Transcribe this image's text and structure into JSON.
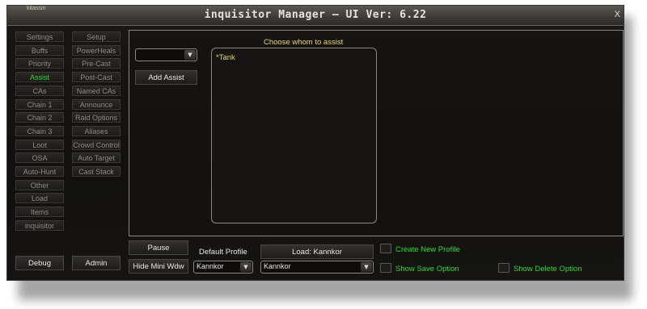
{
  "window": {
    "title": "inquisitor Manager  — UI Ver: 6.22",
    "close_label": "X",
    "corner_text": "kitassin"
  },
  "nav": {
    "left": [
      "Settings",
      "Buffs",
      "Priority",
      "Assist",
      "CAs",
      "Chain 1",
      "Chain 2",
      "Chain 3",
      "Loot",
      "OSA",
      "Auto-Hunt",
      "Other",
      "Load",
      "Items",
      "inquisitor"
    ],
    "right": [
      "Setup",
      "PowerHeals",
      "Pre-Cast",
      "Post-Cast",
      "Named CAs",
      "Announce",
      "Raid Options",
      "Aliases",
      "Crowd Control",
      "Auto Target",
      "Cast Stack"
    ],
    "active": "Assist",
    "debug_label": "Debug",
    "admin_label": "Admin"
  },
  "assist": {
    "dropdown_value": "",
    "add_label": "Add Assist",
    "list_label": "Choose whom to assist",
    "list_items": [
      "*Tank"
    ]
  },
  "footer": {
    "pause_label": "Pause",
    "hide_label": "Hide Mini Wdw",
    "default_profile_label": "Default Profile",
    "default_profile_value": "Kannkor",
    "load_label": "Load: Kannkor",
    "load_profile_value": "Kannkor",
    "create_new_profile_label": "Create New Profile",
    "show_save_label": "Show Save Option",
    "show_delete_label": "Show Delete Option"
  },
  "colors": {
    "active": "#2fdc2f",
    "accent_text": "#e6d96a",
    "window_bg": "#151412"
  }
}
